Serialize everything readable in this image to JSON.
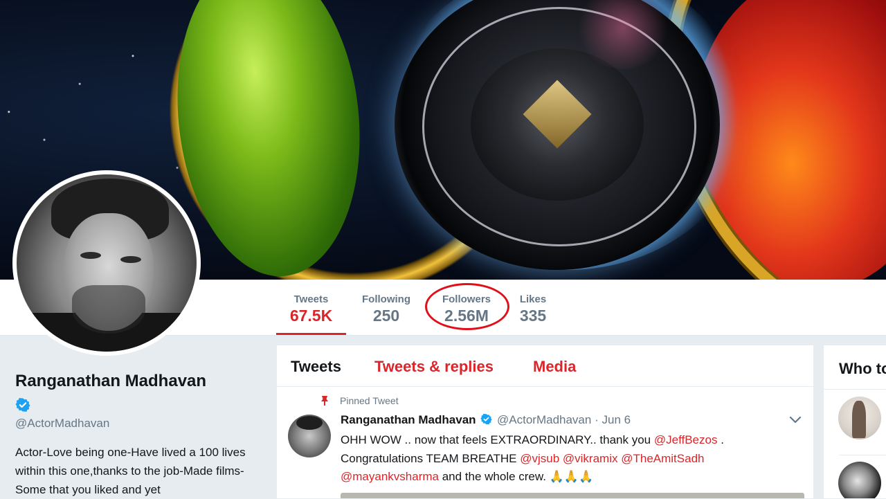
{
  "stats": [
    {
      "label": "Tweets",
      "value": "67.5K",
      "active": true
    },
    {
      "label": "Following",
      "value": "250",
      "active": false
    },
    {
      "label": "Followers",
      "value": "2.56M",
      "active": false
    },
    {
      "label": "Likes",
      "value": "335",
      "active": false
    }
  ],
  "profile": {
    "name": "Ranganathan Madhavan",
    "handle": "@ActorMadhavan",
    "bio": "Actor-Love being one-Have lived a 100 lives within this one,thanks to the job-Made films-Some that you liked and yet"
  },
  "tabs": [
    {
      "label": "Tweets",
      "active": true
    },
    {
      "label": "Tweets & replies",
      "active": false
    },
    {
      "label": "Media",
      "active": false
    }
  ],
  "tweet": {
    "pinned_label": "Pinned Tweet",
    "name": "Ranganathan Madhavan",
    "handle": "@ActorMadhavan",
    "separator": "·",
    "date": "Jun 6",
    "line1_a": "OHH WOW .. now that feels EXTRAORDINARY.. thank you ",
    "mention_jeff": "@JeffBezos",
    "line1_b": " .",
    "line2_a": "Congratulations TEAM BREATHE ",
    "mention_vjsub": "@vjsub",
    "mention_vikramix": "@vikramix",
    "mention_amit": "@TheAmitSadh",
    "mention_mayank": "@mayankvsharma",
    "line3_b": " and the whole crew. ",
    "emoji": "🙏🙏🙏"
  },
  "who_to_follow": {
    "title": "Who to follow"
  },
  "colors": {
    "accent": "#d9262b",
    "muted": "#657786",
    "verified": "#1da1f2",
    "highlight": "#e0101b"
  }
}
